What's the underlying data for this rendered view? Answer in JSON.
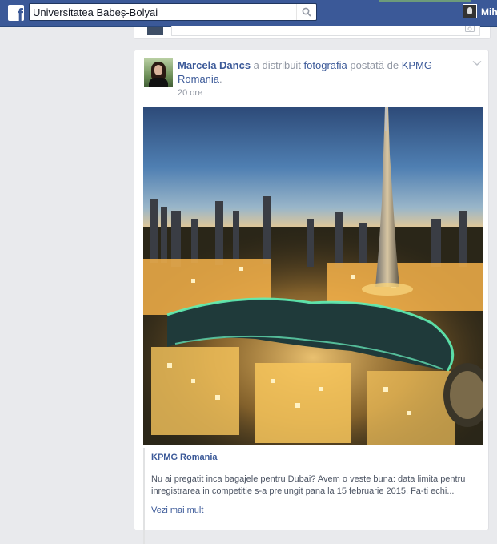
{
  "topbar": {
    "logo": "f",
    "search_value": "Universitatea Babeș-Bolyai",
    "search_icon": "search-icon",
    "user_name": "Mih",
    "bar_color": "#3b5998"
  },
  "post": {
    "author": "Marcela Dancs",
    "action_text": " a distribuit ",
    "object_link": "fotografia",
    "posted_by_text": " postată de ",
    "page_name": "KPMG Romania",
    "period": ".",
    "timestamp": "20 ore",
    "menu_icon": "chevron-down-icon"
  },
  "attachment": {
    "title": "KPMG Romania",
    "description": "Nu ai pregatit inca bagajele pentru Dubai? Avem o veste buna: data limita pentru inregistrarea in competitie s-a prelungit pana la 15 februarie 2015. Fa-ti echi...",
    "see_more": "Vezi mai mult"
  },
  "colors": {
    "link": "#3b5998",
    "meta": "#9197a3",
    "background": "#e9eaed"
  }
}
